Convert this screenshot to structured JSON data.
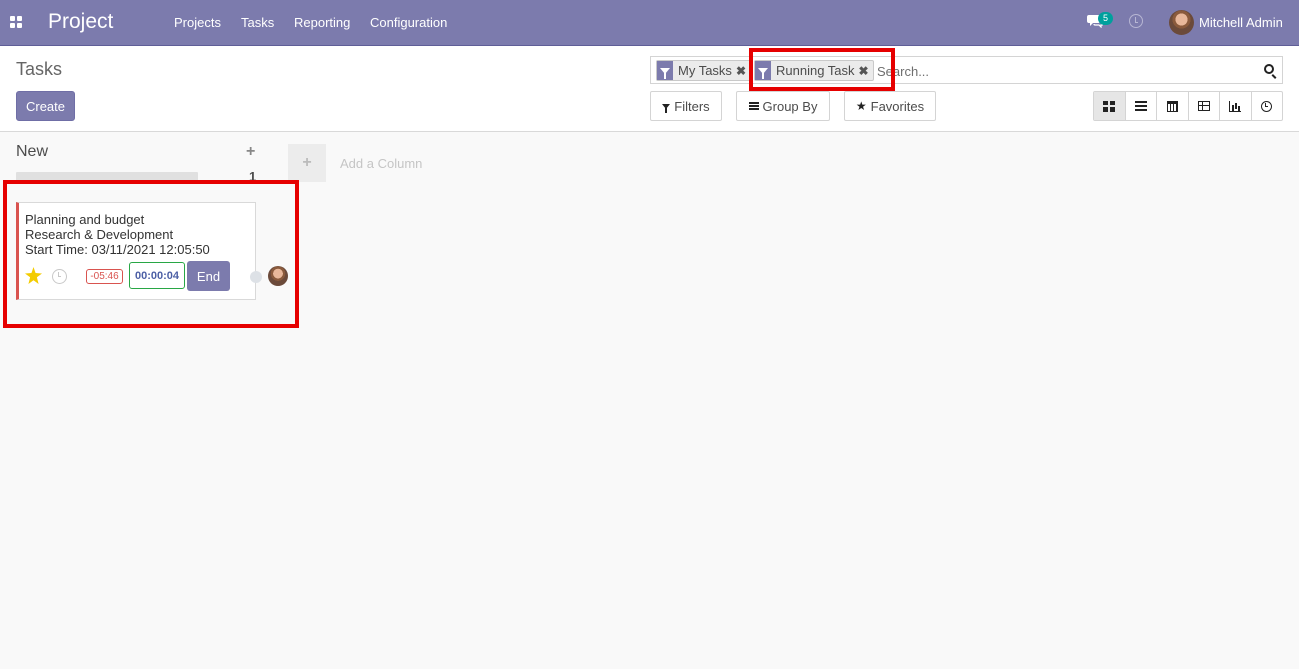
{
  "navbar": {
    "app_name": "Project",
    "menu": [
      "Projects",
      "Tasks",
      "Reporting",
      "Configuration"
    ],
    "messages_count": "5",
    "user_name": "Mitchell Admin"
  },
  "control_panel": {
    "breadcrumb": "Tasks",
    "create_label": "Create",
    "search": {
      "facets": [
        "My Tasks",
        "Running Task"
      ],
      "placeholder": "Search..."
    },
    "filters_label": "Filters",
    "group_by_label": "Group By",
    "favorites_label": "Favorites",
    "views": [
      "kanban-icon",
      "list-icon",
      "calendar-icon",
      "pivot-icon",
      "graph-icon",
      "activity-icon"
    ]
  },
  "kanban": {
    "column": {
      "title": "New",
      "count": "1",
      "add_symbol": "+"
    },
    "add_column_label": "Add a Column",
    "add_column_symbol": "+",
    "card": {
      "task_name": "Planning and budget",
      "project": "Research & Development",
      "start_time": "Start Time: 03/11/2021 12:05:50",
      "deadline": "-05:46",
      "timer": "00:00:04",
      "end_label": "End",
      "priority_starred": true
    }
  },
  "colors": {
    "navbar": "#7c7bad",
    "highlight": "#e60000",
    "timer_border": "#28a745",
    "deadline": "#d9534f"
  }
}
